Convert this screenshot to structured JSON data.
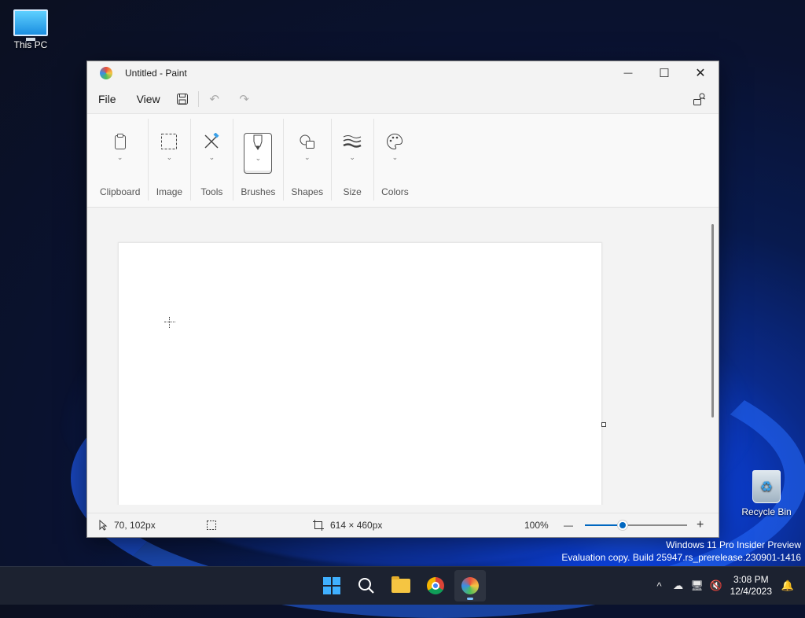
{
  "desktop": {
    "icons": [
      {
        "label": "This PC",
        "icon": "computer-icon"
      },
      {
        "label": "Recycle Bin",
        "icon": "recycle-bin-icon"
      }
    ],
    "watermark": {
      "line1": "Windows 11 Pro Insider Preview",
      "line2": "Evaluation copy. Build 25947.rs_prerelease.230901-1416"
    }
  },
  "window": {
    "title": "Untitled - Paint",
    "controls": {
      "minimize": "—",
      "maximize": "☐",
      "close": "✕"
    }
  },
  "menubar": {
    "file": "File",
    "view": "View",
    "icons": [
      "save-icon",
      "undo-icon",
      "redo-icon",
      "account-icon"
    ]
  },
  "ribbon": {
    "groups": [
      {
        "label": "Clipboard",
        "icon": "clipboard-icon",
        "glyph": "📋"
      },
      {
        "label": "Image",
        "icon": "selection-icon",
        "glyph": "⬚"
      },
      {
        "label": "Tools",
        "icon": "tools-icon",
        "glyph": "✎"
      },
      {
        "label": "Brushes",
        "icon": "brush-icon",
        "glyph": "🖌",
        "active": true
      },
      {
        "label": "Shapes",
        "icon": "shapes-icon",
        "glyph": "◱"
      },
      {
        "label": "Size",
        "icon": "size-icon",
        "glyph": "≋"
      },
      {
        "label": "Colors",
        "icon": "palette-icon",
        "glyph": "🎨"
      }
    ],
    "chevron": "⌄"
  },
  "statusbar": {
    "cursor_position": "70, 102px",
    "canvas_size": "614 × 460px",
    "zoom": "100%",
    "zoom_minus": "—",
    "zoom_plus": "+",
    "zoom_level": 0.37
  },
  "taskbar": {
    "apps": [
      "start-icon",
      "search-icon",
      "file-explorer-icon",
      "chrome-icon",
      "paint-icon"
    ],
    "time": "3:08 PM",
    "date": "12/4/2023",
    "tray_chevron": "^"
  }
}
